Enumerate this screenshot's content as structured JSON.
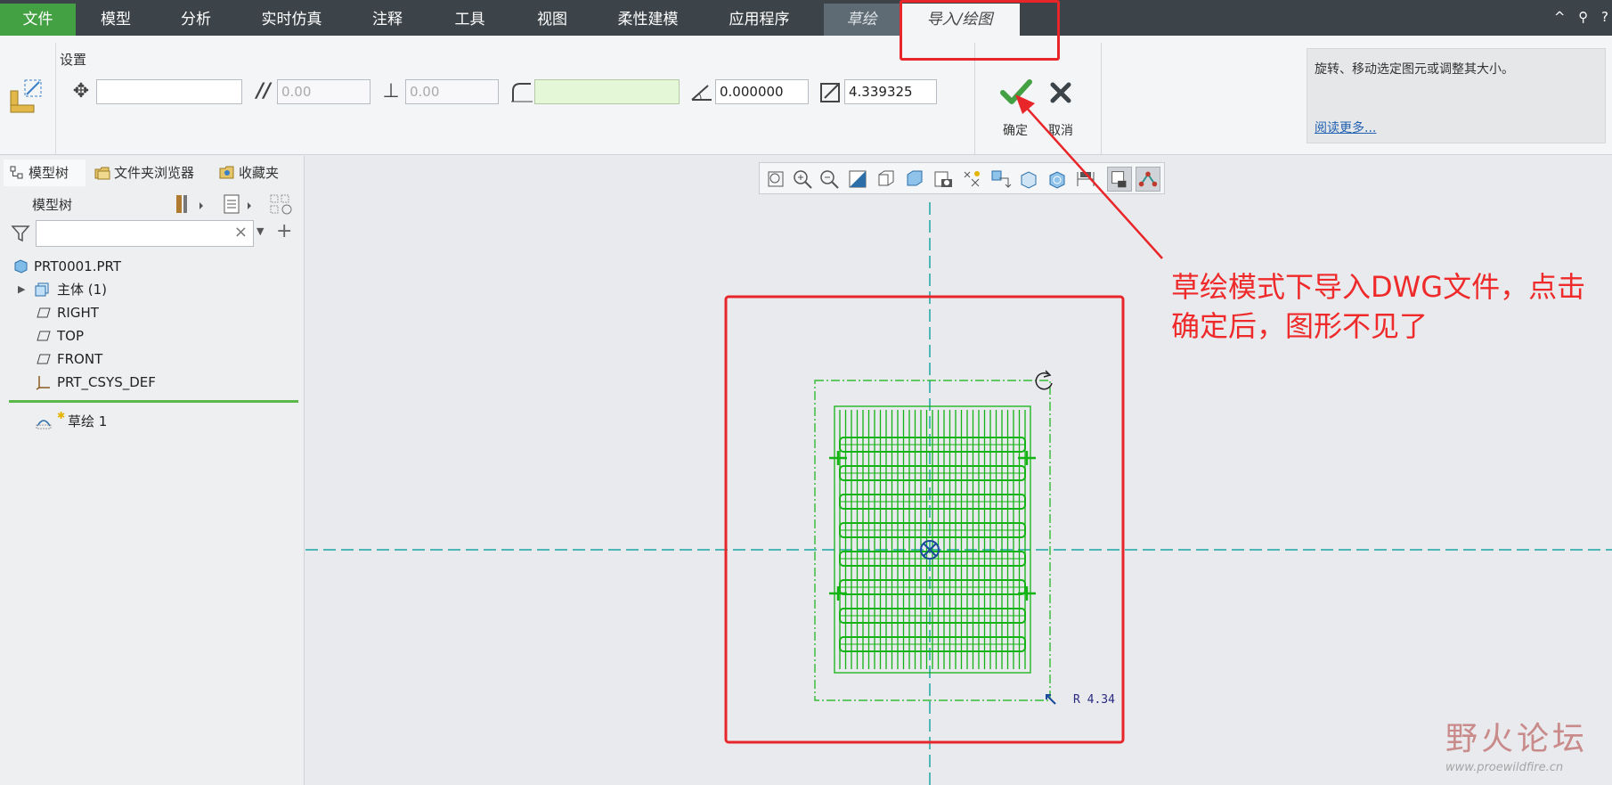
{
  "menu": {
    "tabs": [
      "文件",
      "模型",
      "分析",
      "实时仿真",
      "注释",
      "工具",
      "视图",
      "柔性建模",
      "应用程序",
      "草绘",
      "导入/绘图"
    ],
    "right_icons": [
      "^",
      "⚲",
      "?"
    ]
  },
  "ribbon": {
    "group_label": "设置",
    "fields": {
      "move": "",
      "parallel": "0.00",
      "perpendicular": "0.00",
      "offset": "",
      "angle": "0.000000",
      "scale": "4.339325"
    },
    "ok_label": "确定",
    "cancel_label": "取消",
    "help_text": "旋转、移动选定图元或调整其大小。",
    "help_link": "阅读更多..."
  },
  "panel": {
    "tabs": [
      "模型树",
      "文件夹浏览器",
      "收藏夹"
    ],
    "tree_title": "模型树",
    "search_placeholder": "",
    "items": [
      {
        "label": "PRT0001.PRT",
        "icon": "part-icon"
      },
      {
        "label": "主体 (1)",
        "icon": "body-icon"
      },
      {
        "label": "RIGHT",
        "icon": "datum-plane-icon"
      },
      {
        "label": "TOP",
        "icon": "datum-plane-icon"
      },
      {
        "label": "FRONT",
        "icon": "datum-plane-icon"
      },
      {
        "label": "PRT_CSYS_DEF",
        "icon": "csys-icon"
      },
      {
        "label": "草绘 1",
        "icon": "sketch-icon"
      }
    ]
  },
  "canvas": {
    "scale_label": "R 4.34",
    "annotation": "草绘模式下导入DWG文件，点击确定后，图形不见了",
    "watermark_brand": "野火论坛",
    "watermark_url": "www.proewildfire.cn"
  },
  "colors": {
    "menubar": "#3c4449",
    "file_tab": "#43a043",
    "sketch_green": "#12b312",
    "annotation_red": "#e8262a",
    "centerline": "#1aa5a0"
  }
}
